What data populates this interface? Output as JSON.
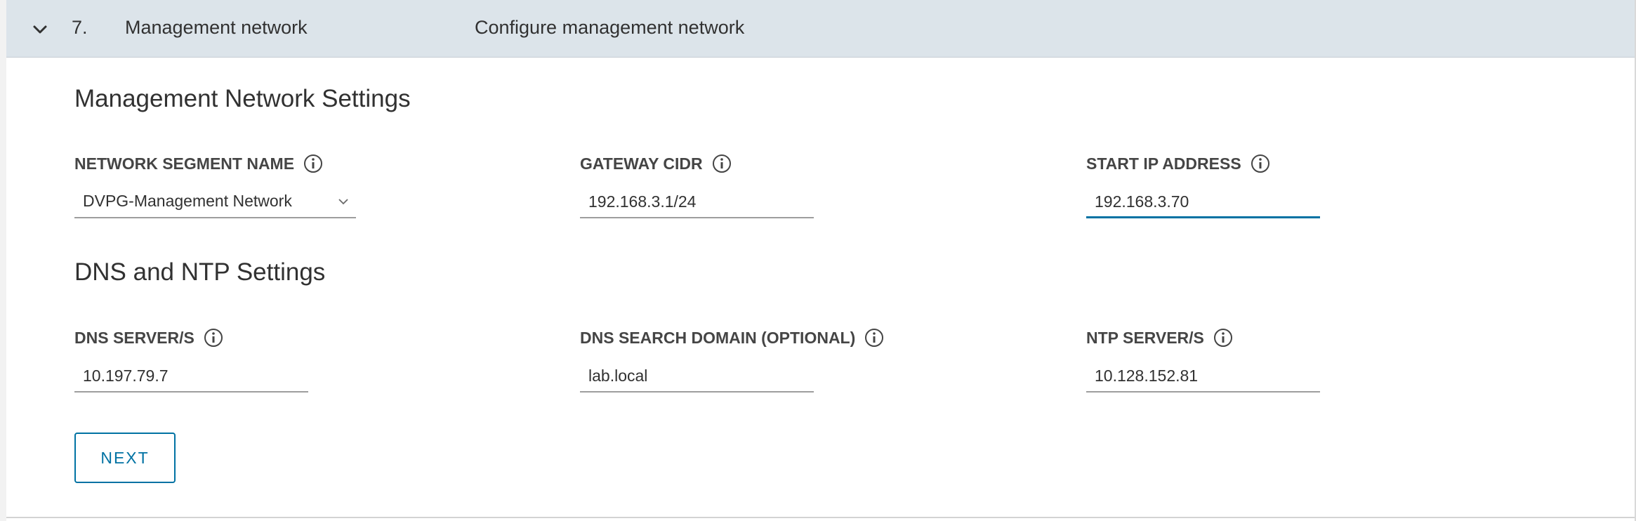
{
  "step": {
    "number": "7.",
    "title": "Management network",
    "description": "Configure management network",
    "expand_icon": "chevron-down-icon"
  },
  "management_section": {
    "title": "Management Network Settings",
    "network_segment": {
      "label": "NETWORK SEGMENT NAME",
      "value": "DVPG-Management Network",
      "icon": "info-icon"
    },
    "gateway_cidr": {
      "label": "GATEWAY CIDR",
      "value": "192.168.3.1/24",
      "icon": "info-icon"
    },
    "start_ip": {
      "label": "START IP ADDRESS",
      "value": "192.168.3.70",
      "icon": "info-icon"
    }
  },
  "dns_section": {
    "title": "DNS and NTP Settings",
    "dns_servers": {
      "label": "DNS SERVER/S",
      "value": "10.197.79.7",
      "icon": "info-icon"
    },
    "dns_search_domain": {
      "label": "DNS SEARCH DOMAIN (OPTIONAL)",
      "value": "lab.local",
      "icon": "info-icon"
    },
    "ntp_servers": {
      "label": "NTP SERVER/S",
      "value": "10.128.152.81",
      "icon": "info-icon"
    }
  },
  "actions": {
    "next_label": "NEXT"
  },
  "colors": {
    "header_bg": "#dce4ea",
    "accent": "#0072a3",
    "text": "#313131"
  }
}
